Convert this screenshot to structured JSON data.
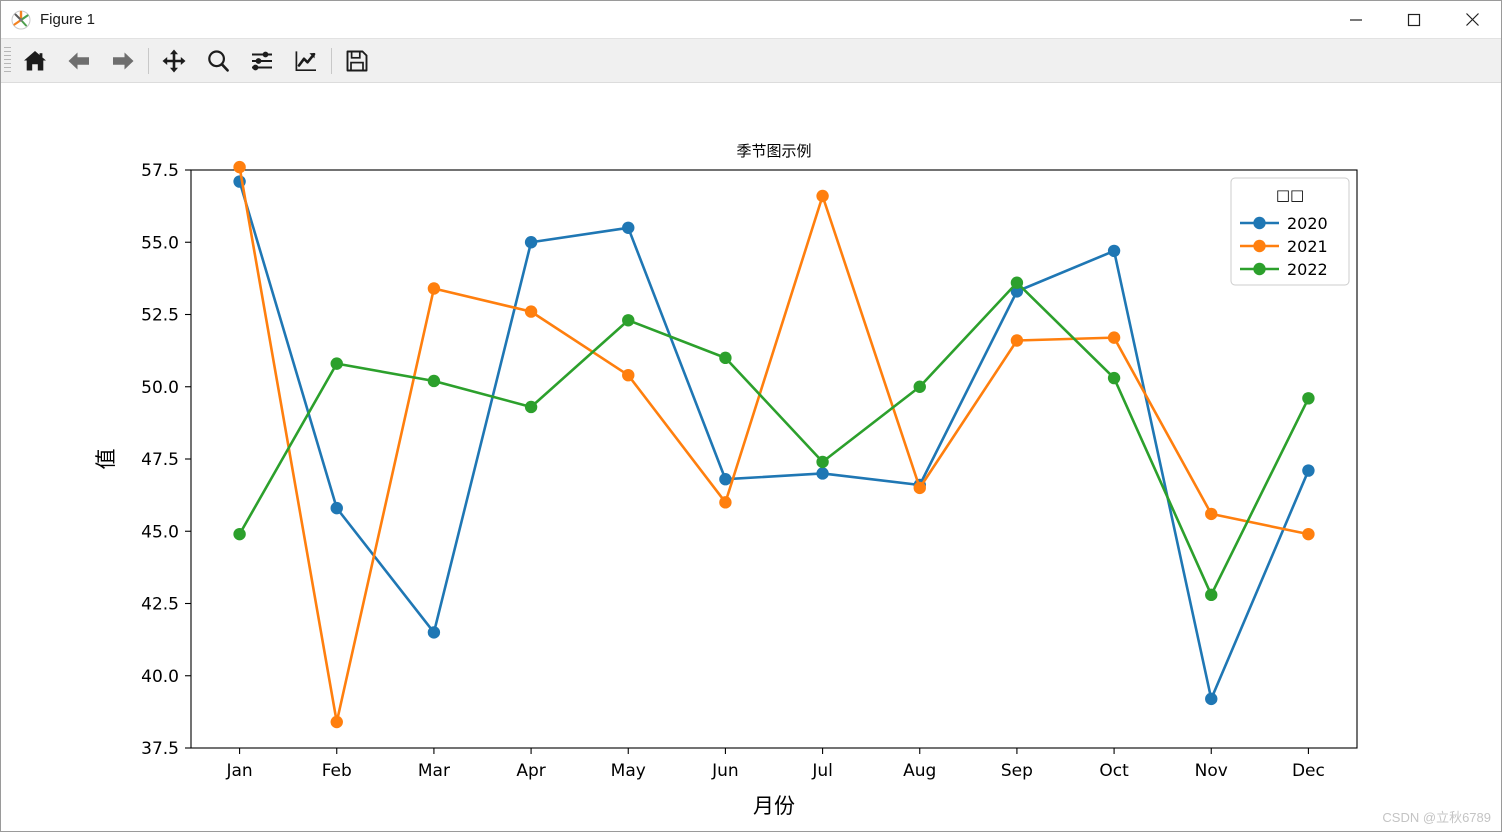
{
  "window": {
    "title": "Figure 1",
    "icon": "matplotlib-logo-icon",
    "minimize_label": "Minimize",
    "maximize_label": "Maximize",
    "close_label": "Close"
  },
  "toolbar": {
    "items": [
      {
        "name": "home-icon",
        "label": "Reset original view"
      },
      {
        "name": "back-arrow-icon",
        "label": "Back to previous view"
      },
      {
        "name": "forward-arrow-icon",
        "label": "Forward to next view"
      },
      {
        "name": "pan-move-icon",
        "label": "Pan axes with left mouse, zoom with right"
      },
      {
        "name": "zoom-magnifier-icon",
        "label": "Zoom to rectangle"
      },
      {
        "name": "sliders-configure-icon",
        "label": "Configure subplots"
      },
      {
        "name": "edit-axis-curve-icon",
        "label": "Edit axis, curve and image parameters"
      },
      {
        "name": "save-floppy-icon",
        "label": "Save the figure"
      }
    ]
  },
  "watermark": "CSDN @立秋6789",
  "chart_data": {
    "type": "line",
    "title": "季节图示例",
    "xlabel": "月份",
    "ylabel": "值",
    "categories": [
      "Jan",
      "Feb",
      "Mar",
      "Apr",
      "May",
      "Jun",
      "Jul",
      "Aug",
      "Sep",
      "Oct",
      "Nov",
      "Dec"
    ],
    "ylim": [
      37.5,
      57.5
    ],
    "yticks": [
      37.5,
      40.0,
      42.5,
      45.0,
      47.5,
      50.0,
      52.5,
      55.0,
      57.5
    ],
    "ytick_labels": [
      "37.5",
      "40.0",
      "42.5",
      "45.0",
      "47.5",
      "50.0",
      "52.5",
      "55.0",
      "57.5"
    ],
    "grid": false,
    "marker": "circle",
    "legend_position": "upper right",
    "legend_title": "□□",
    "legend_title_note": "missing-glyph boxes (tofu) rendered in place of Chinese characters",
    "series": [
      {
        "name": "2020",
        "color": "#1f77b4",
        "values": [
          57.1,
          45.8,
          41.5,
          55.0,
          55.5,
          46.8,
          47.0,
          46.6,
          53.3,
          54.7,
          39.2,
          47.1
        ]
      },
      {
        "name": "2021",
        "color": "#ff7f0e",
        "values": [
          57.6,
          38.4,
          53.4,
          52.6,
          50.4,
          46.0,
          56.6,
          46.5,
          51.6,
          51.7,
          45.6,
          44.9
        ]
      },
      {
        "name": "2022",
        "color": "#2ca02c",
        "values": [
          44.9,
          50.8,
          50.2,
          49.3,
          52.3,
          51.0,
          47.4,
          50.0,
          53.6,
          50.3,
          42.8,
          49.6
        ]
      }
    ]
  }
}
